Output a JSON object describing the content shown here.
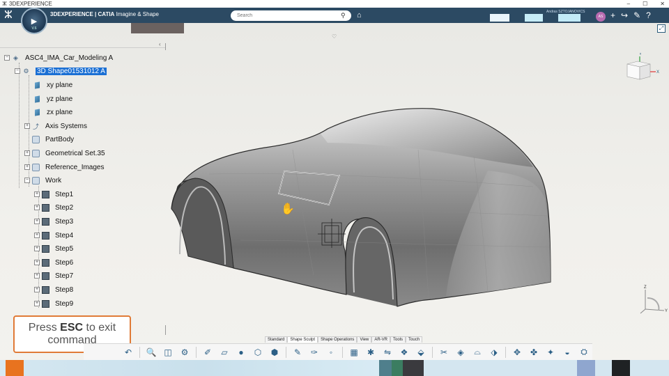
{
  "window": {
    "title": "3DEXPERIENCE",
    "controls": [
      "–",
      "☐",
      "✕"
    ]
  },
  "app": {
    "brand_prefix": "3DEXPERIENCE | CATIA",
    "brand_app": "Imagine & Shape",
    "compass_version": "V.6",
    "search_placeholder": "Search",
    "user_name": "Andras SZTOJANOVICS",
    "avatar_initials": "AS"
  },
  "tree": {
    "root": "ASC4_IMA_Car_Modeling A",
    "shape": "3D Shape01531012 A",
    "items": [
      {
        "label": "xy plane",
        "icon": "plane-icon"
      },
      {
        "label": "yz plane",
        "icon": "plane-icon"
      },
      {
        "label": "zx plane",
        "icon": "plane-icon"
      },
      {
        "label": "Axis Systems",
        "icon": "axis-system-icon"
      },
      {
        "label": "PartBody",
        "icon": "partbody-icon"
      },
      {
        "label": "Geometrical Set.35",
        "icon": "geometrical-set-icon"
      },
      {
        "label": "Reference_Images",
        "icon": "geometrical-set-icon"
      },
      {
        "label": "Work",
        "icon": "geometrical-set-icon"
      }
    ],
    "steps": [
      "Step1",
      "Step2",
      "Step3",
      "Step4",
      "Step5",
      "Step6",
      "Step7",
      "Step8",
      "Step9"
    ]
  },
  "hint": {
    "line1_prefix": "Press ",
    "line1_key": "ESC",
    "line1_suffix": " to exit",
    "line2": "command"
  },
  "toolbar_tabs": [
    "Standard",
    "Shape Sculpt",
    "Shape Operations",
    "View",
    "AR-VR",
    "Tools",
    "Touch"
  ],
  "active_tab": "Shape Sculpt",
  "axis_labels": {
    "y": "Y",
    "x": "X",
    "z": "Z"
  },
  "colors": {
    "appbar": "#2c4a63",
    "selection": "#1a6fd4",
    "hint_border": "#e07a36"
  }
}
